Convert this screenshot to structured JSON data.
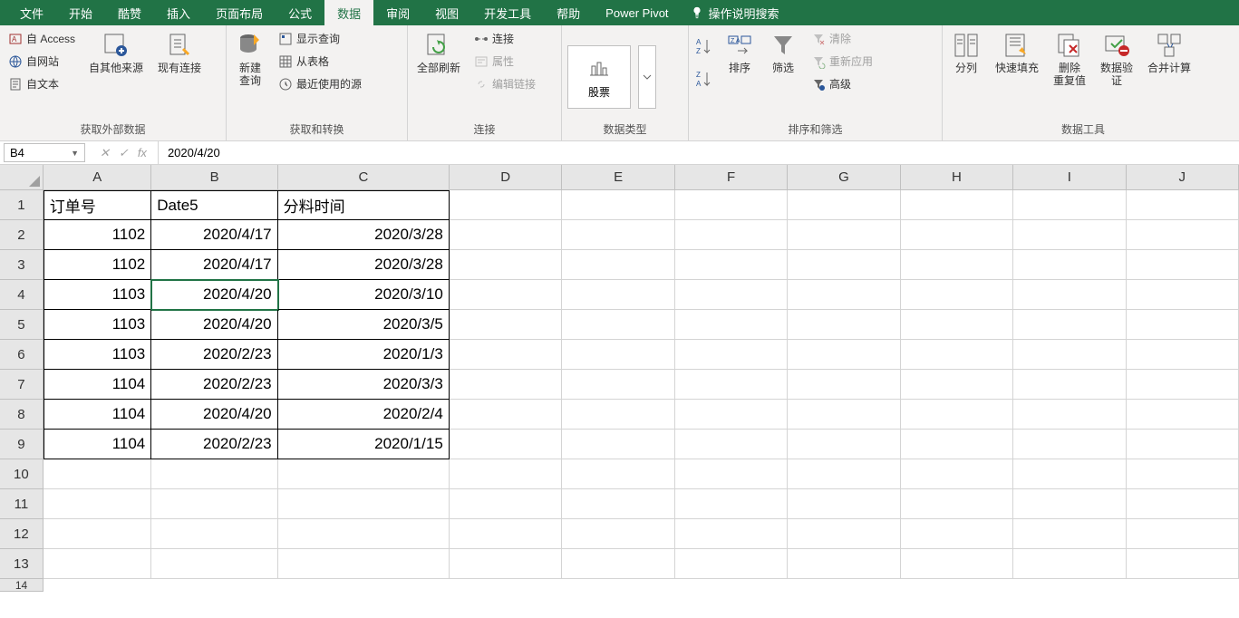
{
  "menuTabs": [
    "文件",
    "开始",
    "酷赞",
    "插入",
    "页面布局",
    "公式",
    "数据",
    "审阅",
    "视图",
    "开发工具",
    "帮助",
    "Power Pivot"
  ],
  "activeTab": "数据",
  "tellMe": "操作说明搜索",
  "ribbon": {
    "group1": {
      "label": "获取外部数据",
      "access": "自 Access",
      "web": "自网站",
      "text": "自文本",
      "other": "自其他来源",
      "existing": "现有连接"
    },
    "group2": {
      "label": "获取和转换",
      "newQuery": "新建\n查询",
      "showQuery": "显示查询",
      "fromTable": "从表格",
      "recent": "最近使用的源"
    },
    "group3": {
      "label": "连接",
      "refreshAll": "全部刷新",
      "connections": "连接",
      "properties": "属性",
      "editLinks": "编辑链接"
    },
    "group4": {
      "label": "数据类型",
      "stock": "股票"
    },
    "group5": {
      "label": "排序和筛选",
      "sort": "排序",
      "filter": "筛选",
      "clear": "清除",
      "reapply": "重新应用",
      "advanced": "高级"
    },
    "group6": {
      "label": "数据工具",
      "textToCol": "分列",
      "flashFill": "快速填充",
      "removeDup": "删除\n重复值",
      "validation": "数据验\n证",
      "consolidate": "合并计算"
    }
  },
  "nameBox": "B4",
  "formulaValue": "2020/4/20",
  "columns": [
    "A",
    "B",
    "C",
    "D",
    "E",
    "F",
    "G",
    "H",
    "I",
    "J"
  ],
  "rowCount": 13,
  "headers": [
    "订单号",
    "Date5",
    "分料时间"
  ],
  "rows": [
    [
      "1102",
      "2020/4/17",
      "2020/3/28"
    ],
    [
      "1102",
      "2020/4/17",
      "2020/3/28"
    ],
    [
      "1103",
      "2020/4/20",
      "2020/3/10"
    ],
    [
      "1103",
      "2020/4/20",
      "2020/3/5"
    ],
    [
      "1103",
      "2020/2/23",
      "2020/1/3"
    ],
    [
      "1104",
      "2020/2/23",
      "2020/3/3"
    ],
    [
      "1104",
      "2020/4/20",
      "2020/2/4"
    ],
    [
      "1104",
      "2020/2/23",
      "2020/1/15"
    ]
  ],
  "selectedCell": {
    "row": 4,
    "col": "B"
  }
}
